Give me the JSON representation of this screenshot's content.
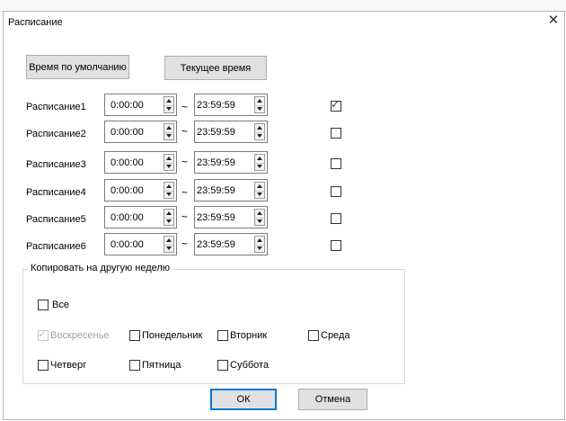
{
  "window": {
    "title": "Расписание",
    "close_glyph": "✕"
  },
  "buttons": {
    "default_time": "Время по умолчанию",
    "current_time": "Текущее время",
    "ok": "ОК",
    "cancel": "Отмена"
  },
  "separator": "~",
  "schedules": [
    {
      "label": "Расписание1",
      "start": "0:00:00",
      "end": "23:59:59",
      "checked": true
    },
    {
      "label": "Расписание2",
      "start": "0:00:00",
      "end": "23:59:59",
      "checked": false
    },
    {
      "label": "Расписание3",
      "start": "0:00:00",
      "end": "23:59:59",
      "checked": false
    },
    {
      "label": "Расписание4",
      "start": "0:00:00",
      "end": "23:59:59",
      "checked": false
    },
    {
      "label": "Расписание5",
      "start": "0:00:00",
      "end": "23:59:59",
      "checked": false
    },
    {
      "label": "Расписание6",
      "start": "0:00:00",
      "end": "23:59:59",
      "checked": false
    }
  ],
  "copy_group": {
    "title": "Копировать на другую неделю",
    "all": {
      "label": "Все",
      "checked": false
    },
    "days": [
      {
        "label": "Воскресенье",
        "checked": true,
        "disabled": true
      },
      {
        "label": "Понедельник",
        "checked": false,
        "disabled": false
      },
      {
        "label": "Вторник",
        "checked": false,
        "disabled": false
      },
      {
        "label": "Среда",
        "checked": false,
        "disabled": false
      },
      {
        "label": "Четверг",
        "checked": false,
        "disabled": false
      },
      {
        "label": "Пятница",
        "checked": false,
        "disabled": false
      },
      {
        "label": "Суббота",
        "checked": false,
        "disabled": false
      }
    ]
  },
  "check_glyph": "✓"
}
